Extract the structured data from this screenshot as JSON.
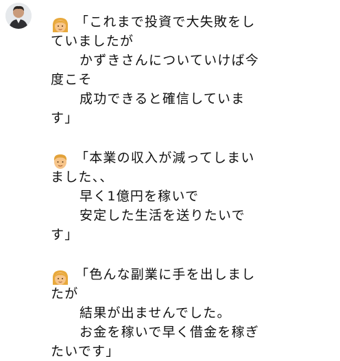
{
  "chat": {
    "avatar_icon": "user-avatar-photo",
    "messages": [
      {
        "emoji_icon": "woman-emoji-icon",
        "lines": [
          "「これまで投資で大失敗をし",
          "ていましたが",
          "かずきさんについていけば今",
          "度こそ",
          "成功できると確信していま",
          "す」"
        ]
      },
      {
        "emoji_icon": "man-emoji-icon",
        "lines": [
          "「本業の収入が減ってしまい",
          "ました、、",
          "早く1億円を稼いで",
          "安定した生活を送りたいで",
          "す」"
        ]
      },
      {
        "emoji_icon": "woman-emoji-icon",
        "lines": [
          "「色んな副業に手を出しまし",
          "たが",
          "結果が出ませんでした。",
          "お金を稼いで早く借金を稼ぎ",
          "たいです」"
        ]
      }
    ]
  },
  "colors": {
    "text": "#111111",
    "emoji_hair_woman": "#E8A93C",
    "emoji_hair_man": "#E2A23A",
    "emoji_skin": "#F7C58A"
  }
}
